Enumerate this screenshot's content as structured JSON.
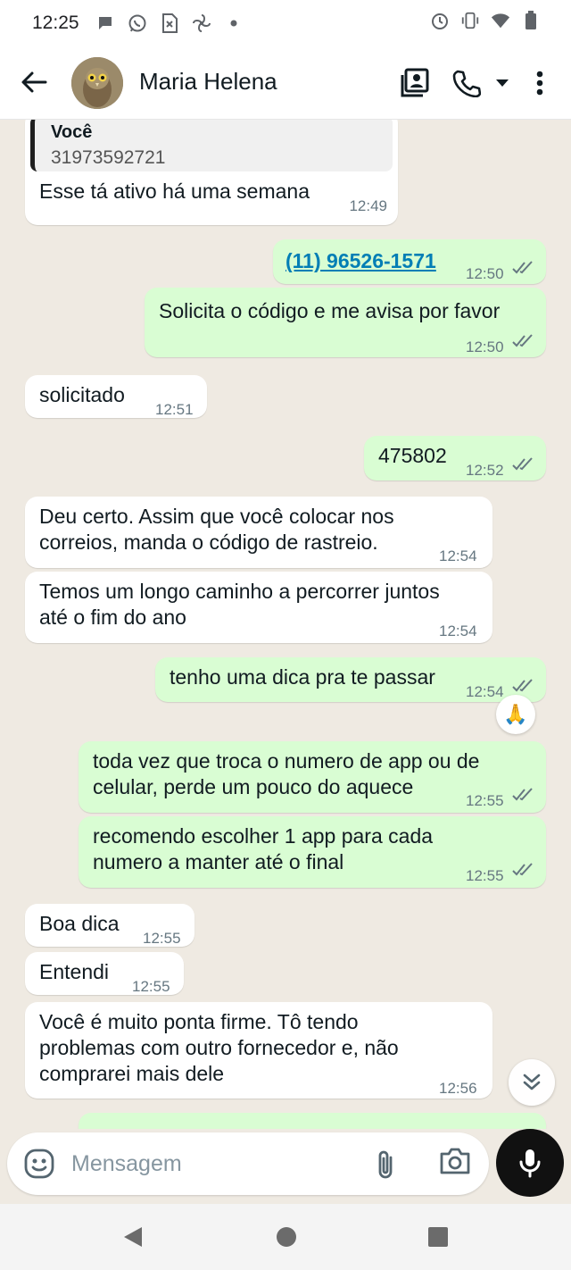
{
  "status_bar": {
    "time": "12:25",
    "left_icons": [
      "chat-bubble-icon",
      "whatsapp-icon",
      "sim-card-icon",
      "pinwheel-icon",
      "dot-icon"
    ],
    "right_icons": [
      "alarm-icon",
      "vibrate-icon",
      "wifi-icon",
      "battery-icon"
    ]
  },
  "header": {
    "contact_name": "Maria Helena",
    "icons": [
      "back-arrow-icon",
      "contact-card-icon",
      "phone-icon",
      "dropdown-arrow-icon",
      "more-vert-icon"
    ]
  },
  "messages": [
    {
      "id": "m1",
      "direction": "in",
      "quote_author": "Você",
      "quote_text": "31973592721",
      "text": "Esse tá ativo há uma semana",
      "time": "12:49"
    },
    {
      "id": "m2",
      "direction": "out",
      "text": "(11) 96526-1571",
      "is_link": true,
      "time": "12:50",
      "status": "read"
    },
    {
      "id": "m3",
      "direction": "out",
      "text": "Solicita o código e me avisa por favor",
      "time": "12:50",
      "status": "read"
    },
    {
      "id": "m4",
      "direction": "in",
      "text": "solicitado",
      "time": "12:51"
    },
    {
      "id": "m5",
      "direction": "out",
      "text": "475802",
      "time": "12:52",
      "status": "read"
    },
    {
      "id": "m6",
      "direction": "in",
      "lines": [
        "Deu certo. Assim que você colocar nos",
        "correios, manda o código de rastreio."
      ],
      "time": "12:54"
    },
    {
      "id": "m7",
      "direction": "in",
      "lines": [
        "Temos um longo caminho a percorrer juntos",
        "até o fim do ano"
      ],
      "time": "12:54"
    },
    {
      "id": "m8",
      "direction": "out",
      "text": "tenho uma dica pra te passar",
      "time": "12:54",
      "status": "read",
      "reaction": "🙏"
    },
    {
      "id": "m9",
      "direction": "out",
      "lines": [
        "toda vez que troca o numero de app ou de",
        "celular, perde um pouco do aquece"
      ],
      "time": "12:55",
      "status": "read"
    },
    {
      "id": "m10",
      "direction": "out",
      "lines": [
        "recomendo escolher 1 app para cada",
        "numero a manter até o final"
      ],
      "time": "12:55",
      "status": "read"
    },
    {
      "id": "m11",
      "direction": "in",
      "text": "Boa dica",
      "time": "12:55"
    },
    {
      "id": "m12",
      "direction": "in",
      "text": "Entendi",
      "time": "12:55"
    },
    {
      "id": "m13",
      "direction": "in",
      "lines": [
        "Você é muito ponta firme. Tô tendo",
        "problemas com outro fornecedor e, não",
        "comprarei mais dele"
      ],
      "time": "12:56"
    }
  ],
  "composer": {
    "placeholder": "Mensagem",
    "icons": [
      "emoji-icon",
      "attach-clip-icon",
      "camera-icon",
      "microphone-icon"
    ]
  },
  "nav_bar": {
    "icons": [
      "nav-back-icon",
      "nav-home-icon",
      "nav-recents-icon"
    ]
  },
  "colors": {
    "chat_background": "#efeae2",
    "incoming_bubble": "#ffffff",
    "outgoing_bubble": "#d9fdd3",
    "link": "#027eb5",
    "timestamp": "#667781",
    "read_ticks": "#667781"
  }
}
